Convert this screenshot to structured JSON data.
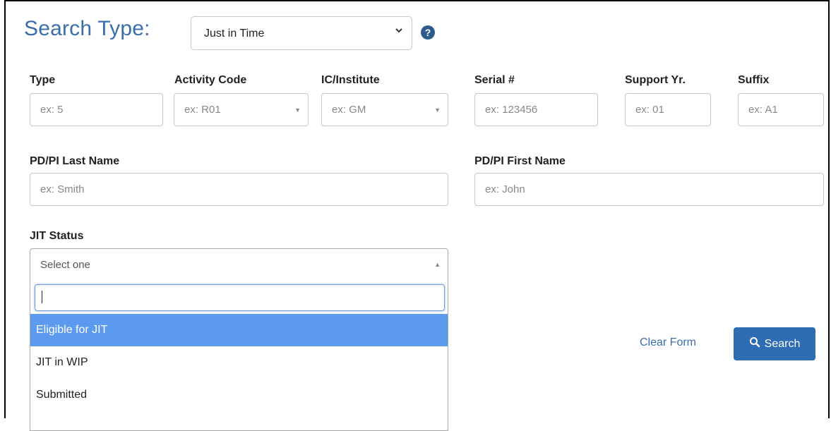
{
  "search_type": {
    "label": "Search Type:",
    "selected": "Just in Time"
  },
  "fields": {
    "type": {
      "label": "Type",
      "placeholder": "ex: 5"
    },
    "activity_code": {
      "label": "Activity Code",
      "placeholder": "ex: R01"
    },
    "ic_institute": {
      "label": "IC/Institute",
      "placeholder": "ex: GM"
    },
    "serial": {
      "label": "Serial #",
      "placeholder": "ex: 123456"
    },
    "support_yr": {
      "label": "Support Yr.",
      "placeholder": "ex: 01"
    },
    "suffix": {
      "label": "Suffix",
      "placeholder": "ex: A1"
    },
    "pi_last": {
      "label": "PD/PI Last Name",
      "placeholder": "ex: Smith"
    },
    "pi_first": {
      "label": "PD/PI First Name",
      "placeholder": "ex: John"
    }
  },
  "jit_status": {
    "label": "JIT Status",
    "placeholder": "Select one",
    "options": [
      "Eligible for JIT",
      "JIT in WIP",
      "Submitted"
    ],
    "highlighted_index": 0
  },
  "actions": {
    "clear": "Clear Form",
    "search": "Search"
  },
  "colors": {
    "accent": "#2e6cb3",
    "highlight": "#5b9aef",
    "title": "#3a6ea8"
  },
  "icons": {
    "help": "question-circle-icon",
    "search": "magnifier-icon"
  }
}
